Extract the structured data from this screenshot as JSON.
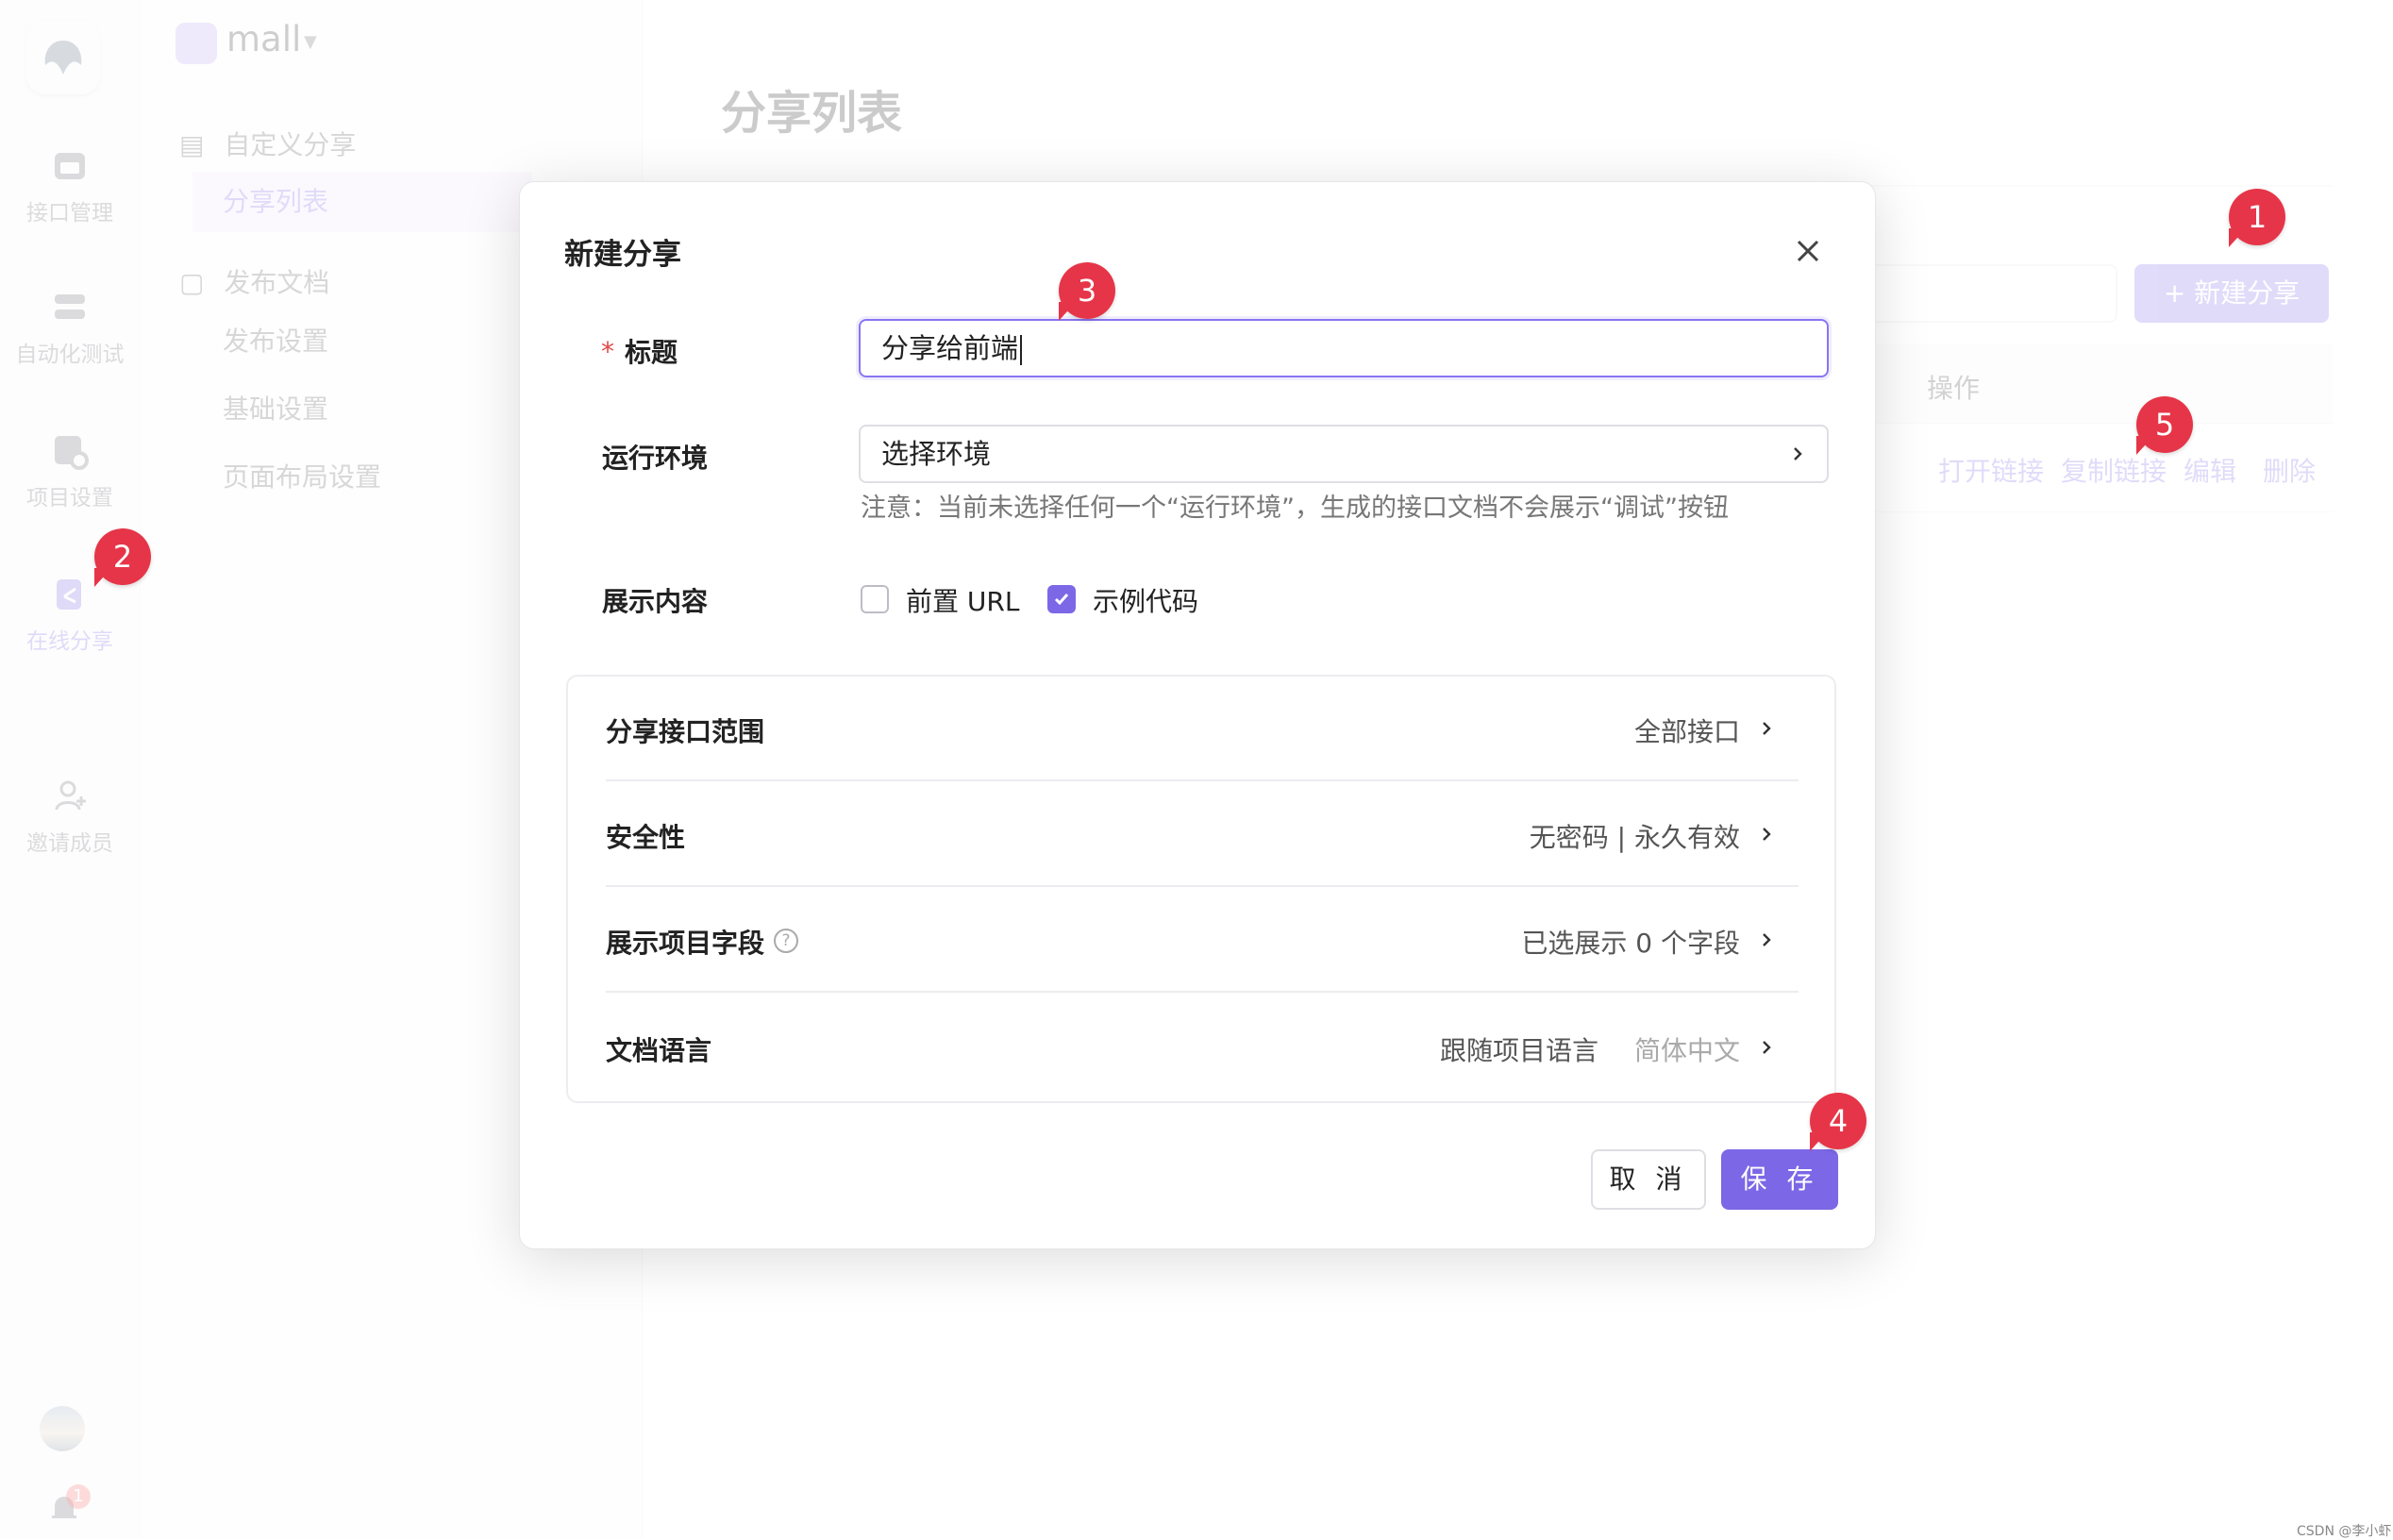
{
  "rail": {
    "items": [
      {
        "label": "接口管理",
        "icon": "api-icon"
      },
      {
        "label": "自动化测试",
        "icon": "automation-icon"
      },
      {
        "label": "项目设置",
        "icon": "settings-icon"
      },
      {
        "label": "在线分享",
        "icon": "share-icon"
      },
      {
        "label": "邀请成员",
        "icon": "invite-icon"
      }
    ],
    "notification_count": "1"
  },
  "sidebar": {
    "project_name": "mall",
    "groups": [
      {
        "label": "自定义分享",
        "items": [
          "分享列表"
        ]
      },
      {
        "label": "发布文档",
        "items": [
          "发布设置",
          "基础设置",
          "页面布局设置"
        ]
      }
    ]
  },
  "main": {
    "title": "分享列表",
    "new_button": "+ 新建分享",
    "table_header_action": "操作",
    "row_actions": [
      "打开链接",
      "复制链接",
      "编辑",
      "删除"
    ]
  },
  "modal": {
    "title": "新建分享",
    "required_mark": "*",
    "fields": {
      "title_label": "标题",
      "title_value": "分享给前端",
      "env_label": "运行环境",
      "env_placeholder": "选择环境",
      "env_note": "注意：当前未选择任何一个“运行环境”，生成的接口文档不会展示“调试”按钮",
      "content_label": "展示内容",
      "option_prefix_url": "前置 URL",
      "option_prefix_url_checked": false,
      "option_sample_code": "示例代码",
      "option_sample_code_checked": true
    },
    "panel_rows": [
      {
        "label": "分享接口范围",
        "value": "全部接口"
      },
      {
        "label": "安全性",
        "value": "无密码 | 永久有效"
      },
      {
        "label": "展示项目字段",
        "value": "已选展示 0 个字段"
      },
      {
        "label": "文档语言",
        "value": "跟随项目语言",
        "value2": "简体中文"
      }
    ],
    "cancel": "取 消",
    "save": "保 存"
  },
  "callouts": [
    "1",
    "2",
    "3",
    "4",
    "5"
  ],
  "watermark": "CSDN @李小虾",
  "colors": {
    "accent": "#7c67e6",
    "callout": "#e63548",
    "required": "#e34848"
  }
}
